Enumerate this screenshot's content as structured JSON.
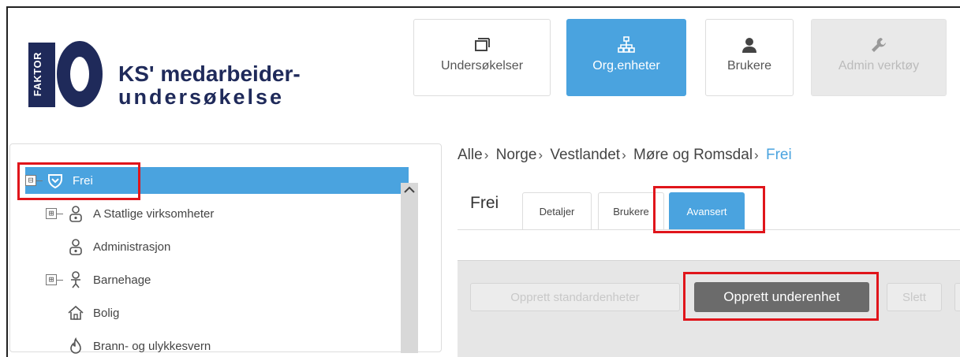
{
  "logo": {
    "badge": "FAKTOR",
    "number": "10",
    "line1": "KS' medarbeider-",
    "line2": "undersøkelse",
    "brand_color": "#1f2a5a"
  },
  "nav": [
    {
      "label": "Undersøkelser",
      "icon": "window-stack-icon",
      "state": "default"
    },
    {
      "label": "Org.enheter",
      "icon": "org-chart-icon",
      "state": "active"
    },
    {
      "label": "Brukere",
      "icon": "user-icon",
      "state": "default"
    },
    {
      "label": "Admin verktøy",
      "icon": "wrench-icon",
      "state": "disabled"
    }
  ],
  "tree": [
    {
      "label": "Frei",
      "toggle": "⊟",
      "icon": "shield-icon",
      "selected": true
    },
    {
      "label": "A Statlige virksomheter",
      "toggle": "⊞",
      "icon": "person-group-icon"
    },
    {
      "label": "Administrasjon",
      "toggle": "",
      "icon": "person-group-icon"
    },
    {
      "label": "Barnehage",
      "toggle": "⊞",
      "icon": "child-icon"
    },
    {
      "label": "Bolig",
      "toggle": "",
      "icon": "house-icon"
    },
    {
      "label": "Brann- og ulykkesvern",
      "toggle": "",
      "icon": "fire-icon"
    }
  ],
  "breadcrumb": {
    "items": [
      "Alle",
      "Norge",
      "Vestlandet",
      "Møre og Romsdal"
    ],
    "current": "Frei",
    "separator": "›"
  },
  "unit_title": "Frei",
  "tabs": [
    {
      "label": "Detaljer"
    },
    {
      "label": "Brukere"
    },
    {
      "label": "Avansert",
      "active": true
    }
  ],
  "actions": {
    "left_disabled": "Opprett standardenheter",
    "primary": "Opprett underenhet",
    "right_disabled": "Slett"
  },
  "colors": {
    "accent": "#4aa3df",
    "highlight": "#e0151b",
    "primary_button": "#6b6b6b"
  }
}
